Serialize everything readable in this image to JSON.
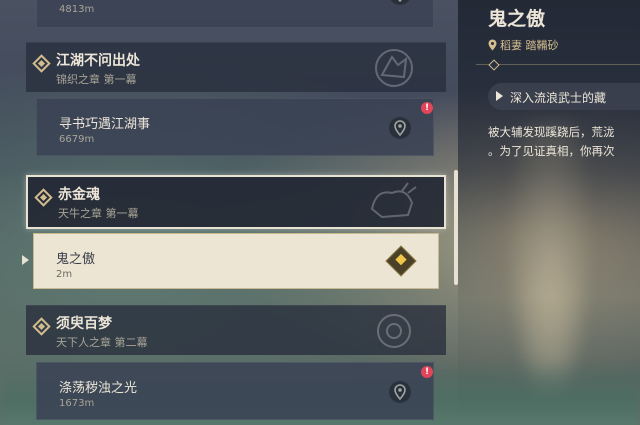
{
  "quest_list": {
    "top_partial": {
      "distance": "4813m"
    },
    "chapters": [
      {
        "title": "江湖不问出处",
        "subtitle": "锦织之章 第一幕",
        "active": false,
        "quest": {
          "name": "寻书巧遇江湖事",
          "distance": "6679m",
          "alert": "!"
        }
      },
      {
        "title": "赤金魂",
        "subtitle": "天牛之章 第一幕",
        "active": true,
        "quest": {
          "name": "鬼之傲",
          "distance": "2m",
          "selected": true
        }
      },
      {
        "title": "须臾百梦",
        "subtitle": "天下人之章 第二幕",
        "active": false,
        "quest": {
          "name": "涤荡秽浊之光",
          "distance": "1673m",
          "alert": "!"
        }
      }
    ]
  },
  "detail": {
    "title": "鬼之傲",
    "location": "稻妻 踏鞴砂",
    "objective": "深入流浪武士的藏",
    "description": [
      "被大辅发现蹊跷后，荒泷",
      "。为了见证真相，你再次"
    ]
  },
  "colors": {
    "accent_gold": "#d3bc8e",
    "alert_red": "#e2455a",
    "selected_bg": "#ede5d4",
    "marker_yellow": "#f3c64a"
  },
  "icons": [
    "diamond-bullet-icon",
    "map-pin-icon",
    "alert-badge-icon",
    "quest-marker-icon",
    "location-pin-icon",
    "play-arrow-icon",
    "chapter-emblem-icon"
  ]
}
